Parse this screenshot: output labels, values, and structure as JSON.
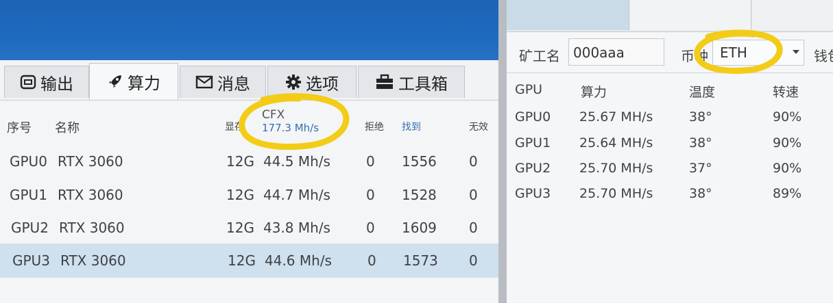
{
  "left": {
    "tabs": [
      {
        "label": "输出",
        "icon": "output-icon"
      },
      {
        "label": "算力",
        "icon": "rocket-icon"
      },
      {
        "label": "消息",
        "icon": "mail-icon"
      },
      {
        "label": "选项",
        "icon": "gear-icon"
      },
      {
        "label": "工具箱",
        "icon": "toolbox-icon"
      }
    ],
    "active_tab": "算力",
    "columns": {
      "index": "序号",
      "name": "名称",
      "memory": "显存",
      "algo": "CFX",
      "algo_total": "177.3 Mh/s",
      "rejected": "拒绝",
      "found": "找到",
      "invalid": "无效"
    },
    "rows": [
      {
        "id": "GPU0",
        "name": "RTX 3060",
        "mem": "12G",
        "rate": "44.5 Mh/s",
        "rejected": "0",
        "found": "1556",
        "invalid": "0"
      },
      {
        "id": "GPU1",
        "name": "RTX 3060",
        "mem": "12G",
        "rate": "44.7 Mh/s",
        "rejected": "0",
        "found": "1528",
        "invalid": "0"
      },
      {
        "id": "GPU2",
        "name": "RTX 3060",
        "mem": "12G",
        "rate": "43.8 Mh/s",
        "rejected": "0",
        "found": "1609",
        "invalid": "0"
      },
      {
        "id": "GPU3",
        "name": "RTX 3060",
        "mem": "12G",
        "rate": "44.6 Mh/s",
        "rejected": "0",
        "found": "1573",
        "invalid": "0"
      }
    ],
    "selected_row": "GPU3"
  },
  "right": {
    "miner_label": "矿工名",
    "miner_value": "000aaa",
    "coin_label": "币种",
    "coin_value": "ETH",
    "wallet_label": "钱包",
    "columns": {
      "gpu": "GPU",
      "hashrate": "算力",
      "temp": "温度",
      "fan": "转速"
    },
    "rows": [
      {
        "gpu": "GPU0",
        "hashrate": "25.67 MH/s",
        "temp": "38°",
        "fan": "90%"
      },
      {
        "gpu": "GPU1",
        "hashrate": "25.64 MH/s",
        "temp": "38°",
        "fan": "90%"
      },
      {
        "gpu": "GPU2",
        "hashrate": "25.70 MH/s",
        "temp": "37°",
        "fan": "90%"
      },
      {
        "gpu": "GPU3",
        "hashrate": "25.70 MH/s",
        "temp": "38°",
        "fan": "89%"
      }
    ]
  },
  "colors": {
    "header_blue": "#1e6bc0",
    "selection": "#cfe0ee",
    "link_blue": "#2f6fb3",
    "annotation_yellow": "#f2cc17"
  }
}
